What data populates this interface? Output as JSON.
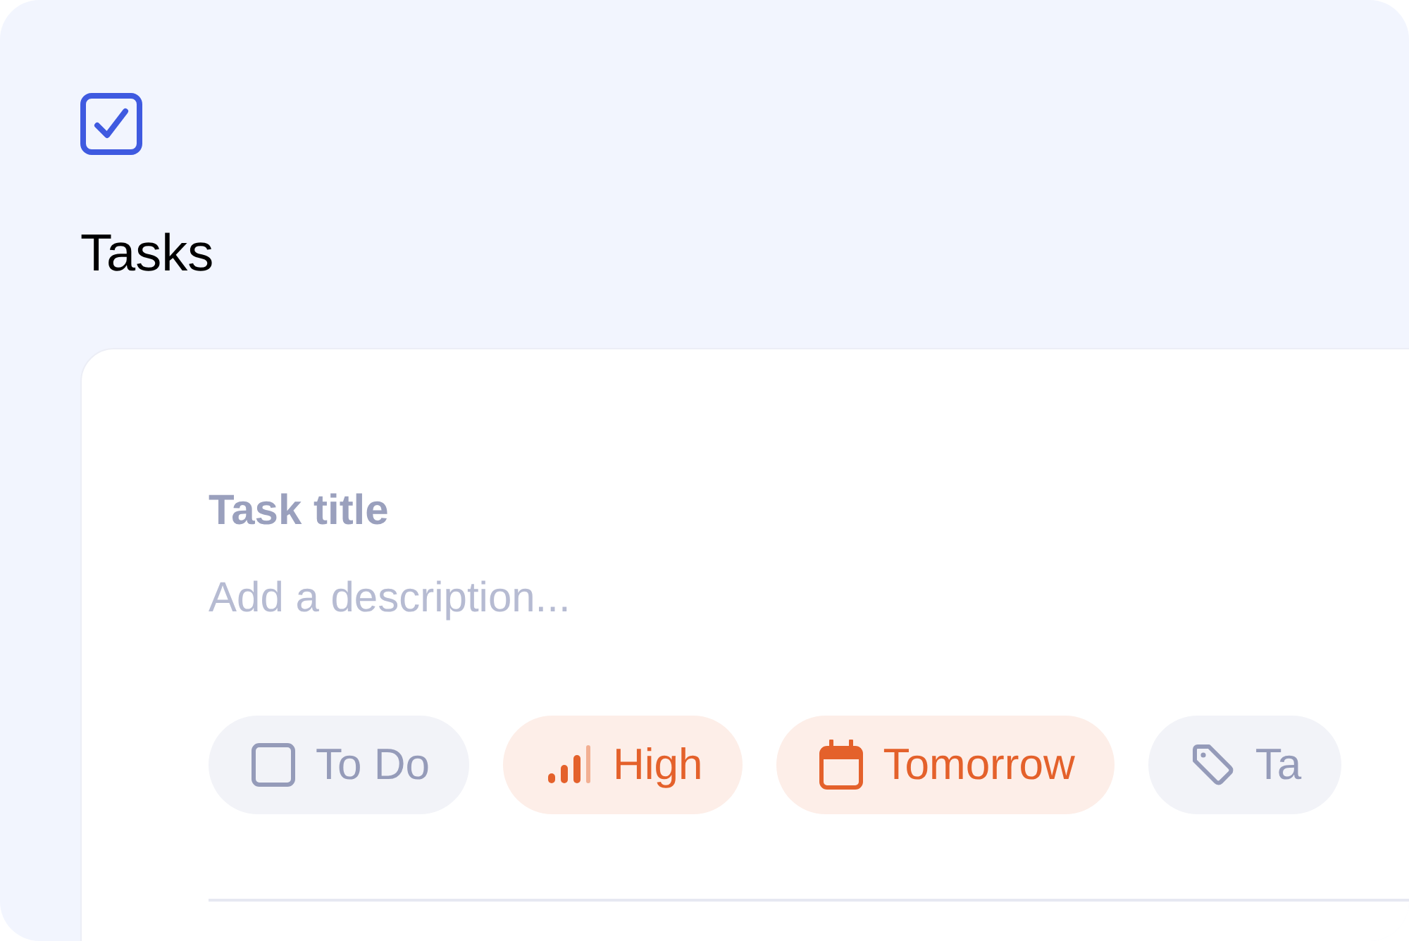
{
  "app": {
    "title": "Tasks"
  },
  "form": {
    "title_placeholder": "Task title",
    "description_placeholder": "Add a description...",
    "chips": [
      {
        "kind": "status",
        "label": "To Do",
        "highlighted": false
      },
      {
        "kind": "priority",
        "label": "High",
        "highlighted": true
      },
      {
        "kind": "date",
        "label": "Tomorrow",
        "highlighted": true
      },
      {
        "kind": "tag",
        "label": "Ta",
        "highlighted": false
      }
    ]
  }
}
